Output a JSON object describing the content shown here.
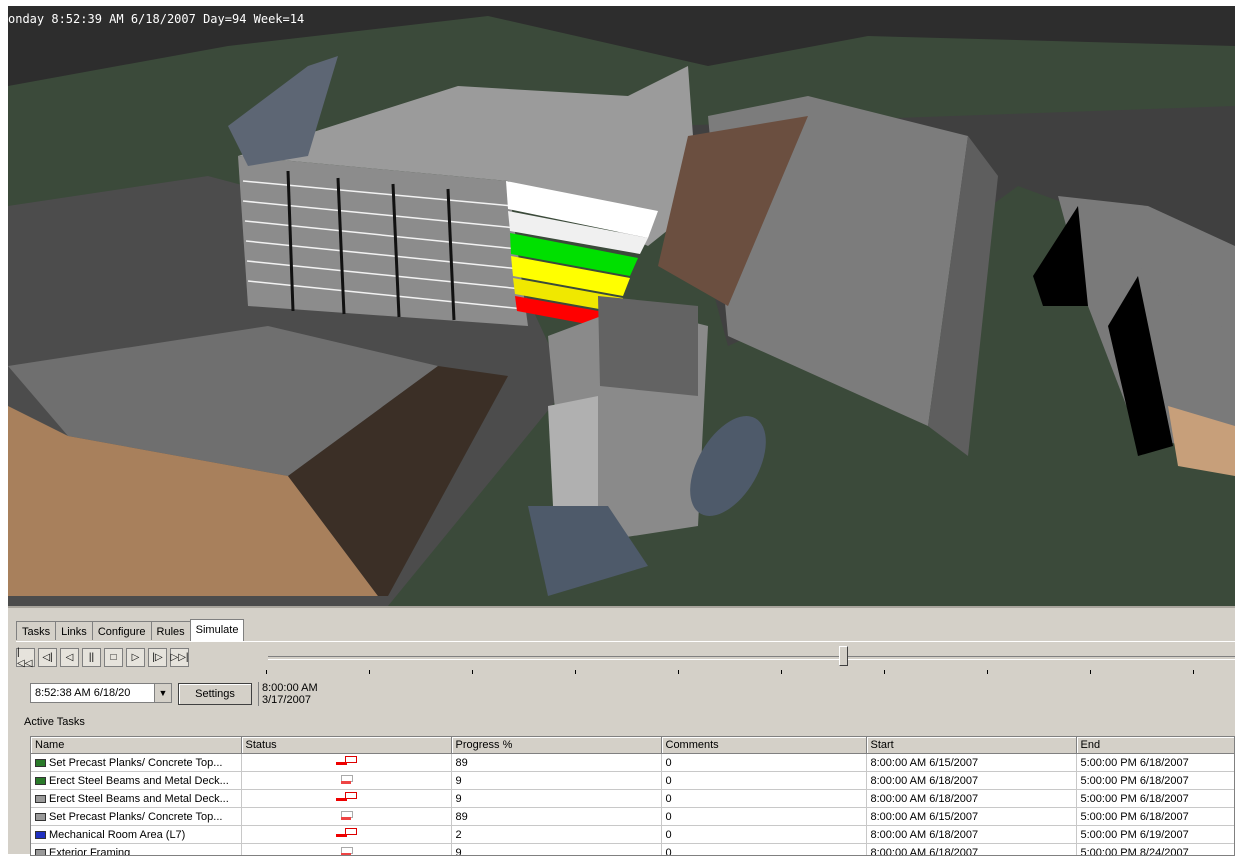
{
  "viewport": {
    "overlay_text": "onday 8:52:39 AM 6/18/2007 Day=94 Week=14"
  },
  "tabs": [
    "Tasks",
    "Links",
    "Configure",
    "Rules",
    "Simulate"
  ],
  "active_tab": "Simulate",
  "playback": {
    "buttons": [
      "go-to-start",
      "step-back",
      "play-reverse",
      "pause",
      "stop",
      "play",
      "step-forward",
      "go-to-end"
    ],
    "button_glyphs": [
      "|◁◁",
      "◁|",
      "◁",
      "||",
      "□",
      "▷",
      "|▷",
      "▷▷|"
    ],
    "slider_position": 0.59
  },
  "controls": {
    "current_date": "8:52:38 AM  6/18/20",
    "settings_label": "Settings",
    "timeline_start_time": "8:00:00 AM",
    "timeline_start_date": "3/17/2007"
  },
  "active_tasks": {
    "title": "Active Tasks",
    "columns": [
      "Name",
      "Status",
      "Progress %",
      "Comments",
      "Start",
      "End"
    ],
    "rows": [
      {
        "name": "Set Precast Planks/ Concrete Top...",
        "icon_color": "#2a7a2a",
        "status": "red",
        "progress": "89",
        "comments": "0",
        "start": "8:00:00 AM 6/15/2007",
        "end": "5:00:00 PM 6/18/2007"
      },
      {
        "name": "Erect Steel Beams and Metal Deck...",
        "icon_color": "#2a7a2a",
        "status": "gray",
        "progress": "9",
        "comments": "0",
        "start": "8:00:00 AM 6/18/2007",
        "end": "5:00:00 PM 6/18/2007"
      },
      {
        "name": "Erect Steel Beams and Metal Deck...",
        "icon_color": "#9a9a9a",
        "status": "red",
        "progress": "9",
        "comments": "0",
        "start": "8:00:00 AM 6/18/2007",
        "end": "5:00:00 PM 6/18/2007"
      },
      {
        "name": "Set Precast Planks/ Concrete Top...",
        "icon_color": "#9a9a9a",
        "status": "gray",
        "progress": "89",
        "comments": "0",
        "start": "8:00:00 AM 6/15/2007",
        "end": "5:00:00 PM 6/18/2007"
      },
      {
        "name": "Mechanical Room Area (L7)",
        "icon_color": "#2030c0",
        "status": "red",
        "progress": "2",
        "comments": "0",
        "start": "8:00:00 AM 6/18/2007",
        "end": "5:00:00 PM 6/19/2007"
      },
      {
        "name": "Exterior Framing",
        "icon_color": "#9a9a9a",
        "status": "gray",
        "progress": "9",
        "comments": "0",
        "start": "8:00:00 AM 6/18/2007",
        "end": "5:00:00 PM 8/24/2007"
      }
    ]
  }
}
